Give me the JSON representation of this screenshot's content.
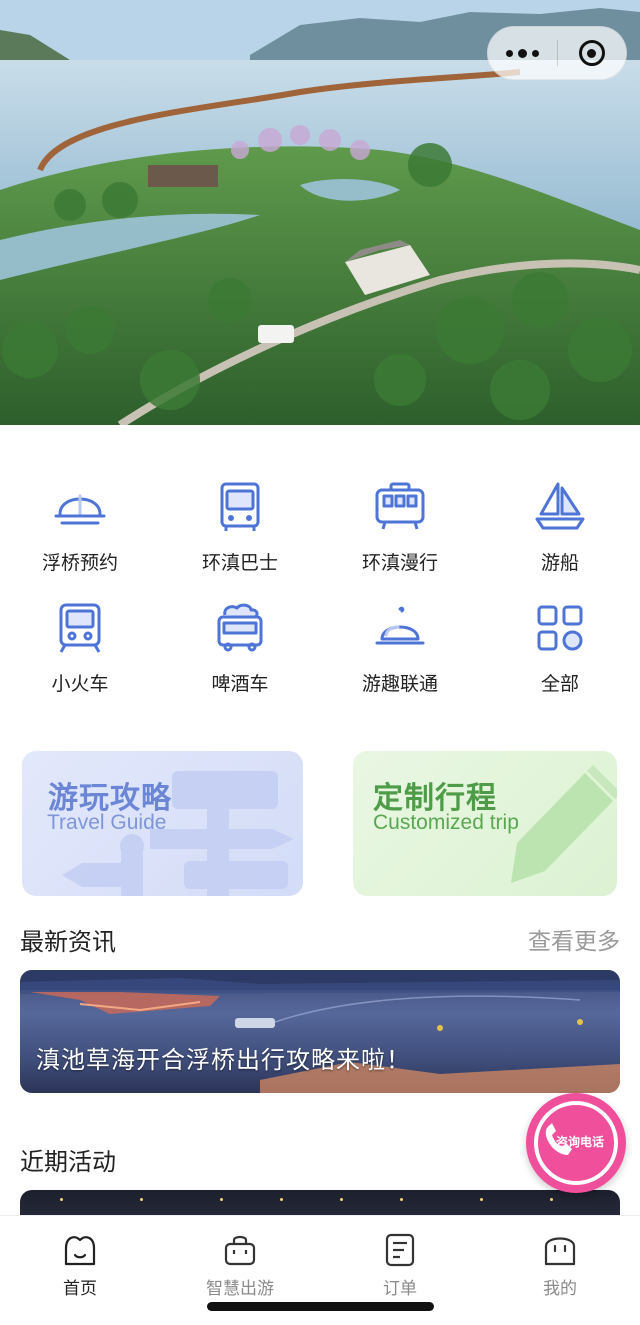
{
  "hero": {
    "more_icon": "more-dots-icon",
    "close_icon": "target-icon"
  },
  "grid": [
    {
      "label": "浮桥预约",
      "icon": "bridge-icon"
    },
    {
      "label": "环滇巴士",
      "icon": "bus-icon"
    },
    {
      "label": "环滇漫行",
      "icon": "tram-icon"
    },
    {
      "label": "游船",
      "icon": "sailboat-icon"
    },
    {
      "label": "小火车",
      "icon": "train-icon"
    },
    {
      "label": "啤酒车",
      "icon": "beer-bus-icon"
    },
    {
      "label": "游趣联通",
      "icon": "service-bell-icon"
    },
    {
      "label": "全部",
      "icon": "grid-all-icon"
    }
  ],
  "cards": {
    "guide": {
      "title": "游玩攻略",
      "subtitle": "Travel Guide"
    },
    "trip": {
      "title": "定制行程",
      "subtitle": "Customized trip"
    }
  },
  "news": {
    "title": "最新资讯",
    "more": "查看更多",
    "item_caption": "滇池草海开合浮桥出行攻略来啦！"
  },
  "activity": {
    "title": "近期活动"
  },
  "consult": {
    "label": "咨询电话",
    "icon": "phone-icon"
  },
  "tabs": [
    {
      "label": "首页",
      "icon": "home-icon",
      "active": true
    },
    {
      "label": "智慧出游",
      "icon": "bag-icon",
      "active": false
    },
    {
      "label": "订单",
      "icon": "order-icon",
      "active": false
    },
    {
      "label": "我的",
      "icon": "profile-icon",
      "active": false
    }
  ],
  "colors": {
    "icon_blue": "#4d74d6",
    "guide_blue": "#6b86d6",
    "trip_green": "#4f9c48",
    "consult_pink": "#ef4f9b"
  }
}
